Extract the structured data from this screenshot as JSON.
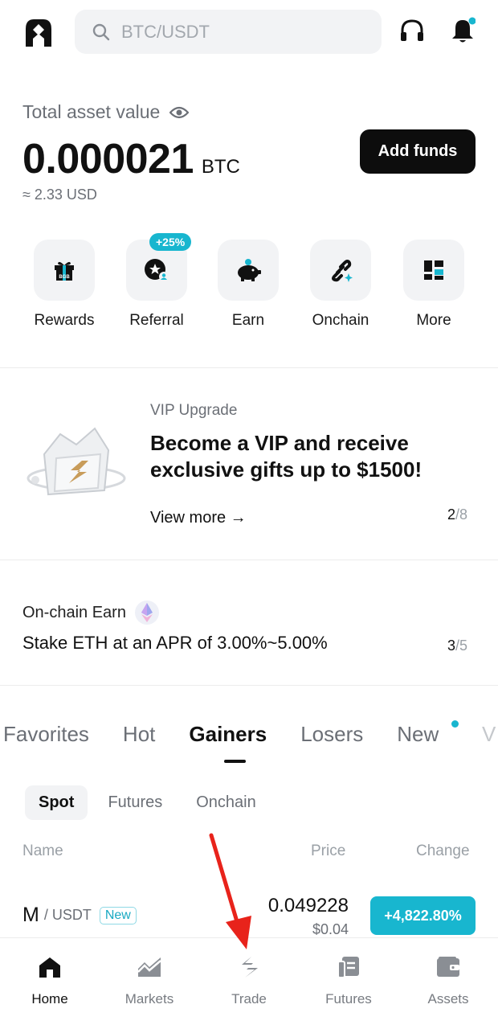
{
  "header": {
    "search_placeholder": "BTC/USDT",
    "icons": [
      "app-logo-icon",
      "search-icon",
      "headset-icon",
      "bell-icon"
    ],
    "notification_dot_color": "#18b6cf"
  },
  "asset": {
    "label": "Total asset value",
    "amount": "0.000021",
    "unit": "BTC",
    "usd": "≈ 2.33 USD",
    "add_funds": "Add funds"
  },
  "quick_actions": [
    {
      "label": "Rewards",
      "icon": "gift-icon"
    },
    {
      "label": "Referral",
      "icon": "referral-icon",
      "badge": "+25%"
    },
    {
      "label": "Earn",
      "icon": "piggy-bank-icon"
    },
    {
      "label": "Onchain",
      "icon": "chain-link-icon"
    },
    {
      "label": "More",
      "icon": "grid-icon"
    }
  ],
  "vip": {
    "label": "VIP Upgrade",
    "title": "Become a VIP and receive exclusive gifts up to $1500!",
    "more": "View more →",
    "page_current": "2",
    "page_total": "/8"
  },
  "onchain": {
    "label": "On-chain Earn",
    "title": "Stake ETH at an APR of 3.00%~5.00%",
    "page_current": "3",
    "page_total": "/5"
  },
  "market": {
    "tabs": [
      "Favorites",
      "Hot",
      "Gainers",
      "Losers",
      "New"
    ],
    "tab_overflow": "V",
    "active_tab": "Gainers",
    "subtabs": [
      "Spot",
      "Futures",
      "Onchain"
    ],
    "columns": {
      "name": "Name",
      "price": "Price",
      "change": "Change"
    },
    "rows": [
      {
        "base": "M",
        "quote": "/ USDT",
        "tag": "New",
        "price": "0.049228",
        "usd": "$0.04",
        "change": "+4,822.80%"
      }
    ],
    "accent": "#18b6cf"
  },
  "bottom_nav": [
    {
      "label": "Home",
      "icon": "home-icon"
    },
    {
      "label": "Markets",
      "icon": "markets-chart-icon"
    },
    {
      "label": "Trade",
      "icon": "trade-icon"
    },
    {
      "label": "Futures",
      "icon": "futures-icon"
    },
    {
      "label": "Assets",
      "icon": "wallet-icon"
    }
  ]
}
